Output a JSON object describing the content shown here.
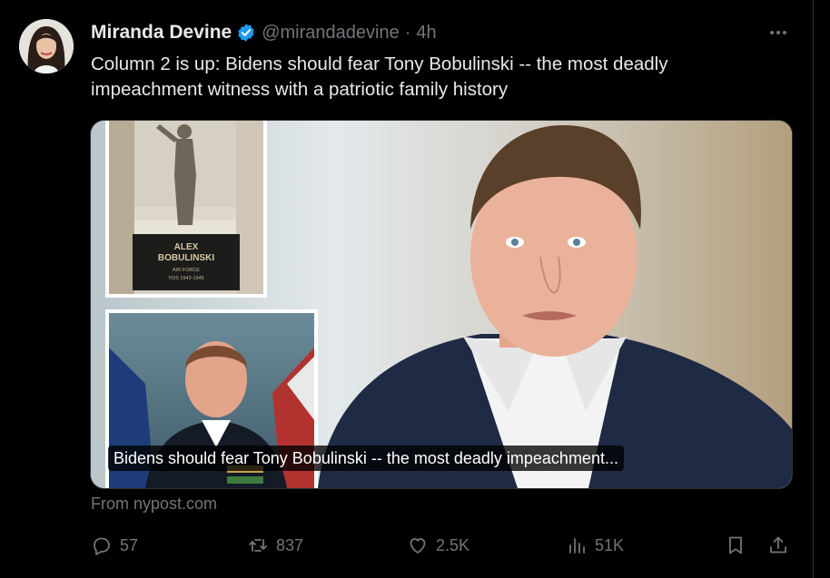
{
  "tweet": {
    "author_name": "Miranda Devine",
    "handle": "@mirandadevine",
    "separator": "·",
    "time": "4h",
    "text_line1": "Column 2 is up: Bidens should fear Tony Bobulinski -- the most deadly",
    "text_line2": "impeachment witness with a patriotic family history"
  },
  "card": {
    "title": "Bidens should fear Tony Bobulinski -- the most deadly impeachment...",
    "plaque_name_1": "ALEX",
    "plaque_name_2": "BOBULINSKI",
    "plaque_line_1": "AIR FORCE",
    "plaque_line_2": "YOS 1942-1945",
    "source": "From nypost.com"
  },
  "actions": {
    "replies": "57",
    "reposts": "837",
    "likes": "2.5K",
    "views": "51K"
  },
  "colors": {
    "background": "#000000",
    "text_primary": "#e7e9ea",
    "text_secondary": "#71767b",
    "verified_badge": "#1d9bf0",
    "border": "#2f3336"
  },
  "icons": [
    "verified-badge-icon",
    "more-icon",
    "reply-icon",
    "repost-icon",
    "like-icon",
    "views-icon",
    "bookmark-icon",
    "share-icon"
  ]
}
